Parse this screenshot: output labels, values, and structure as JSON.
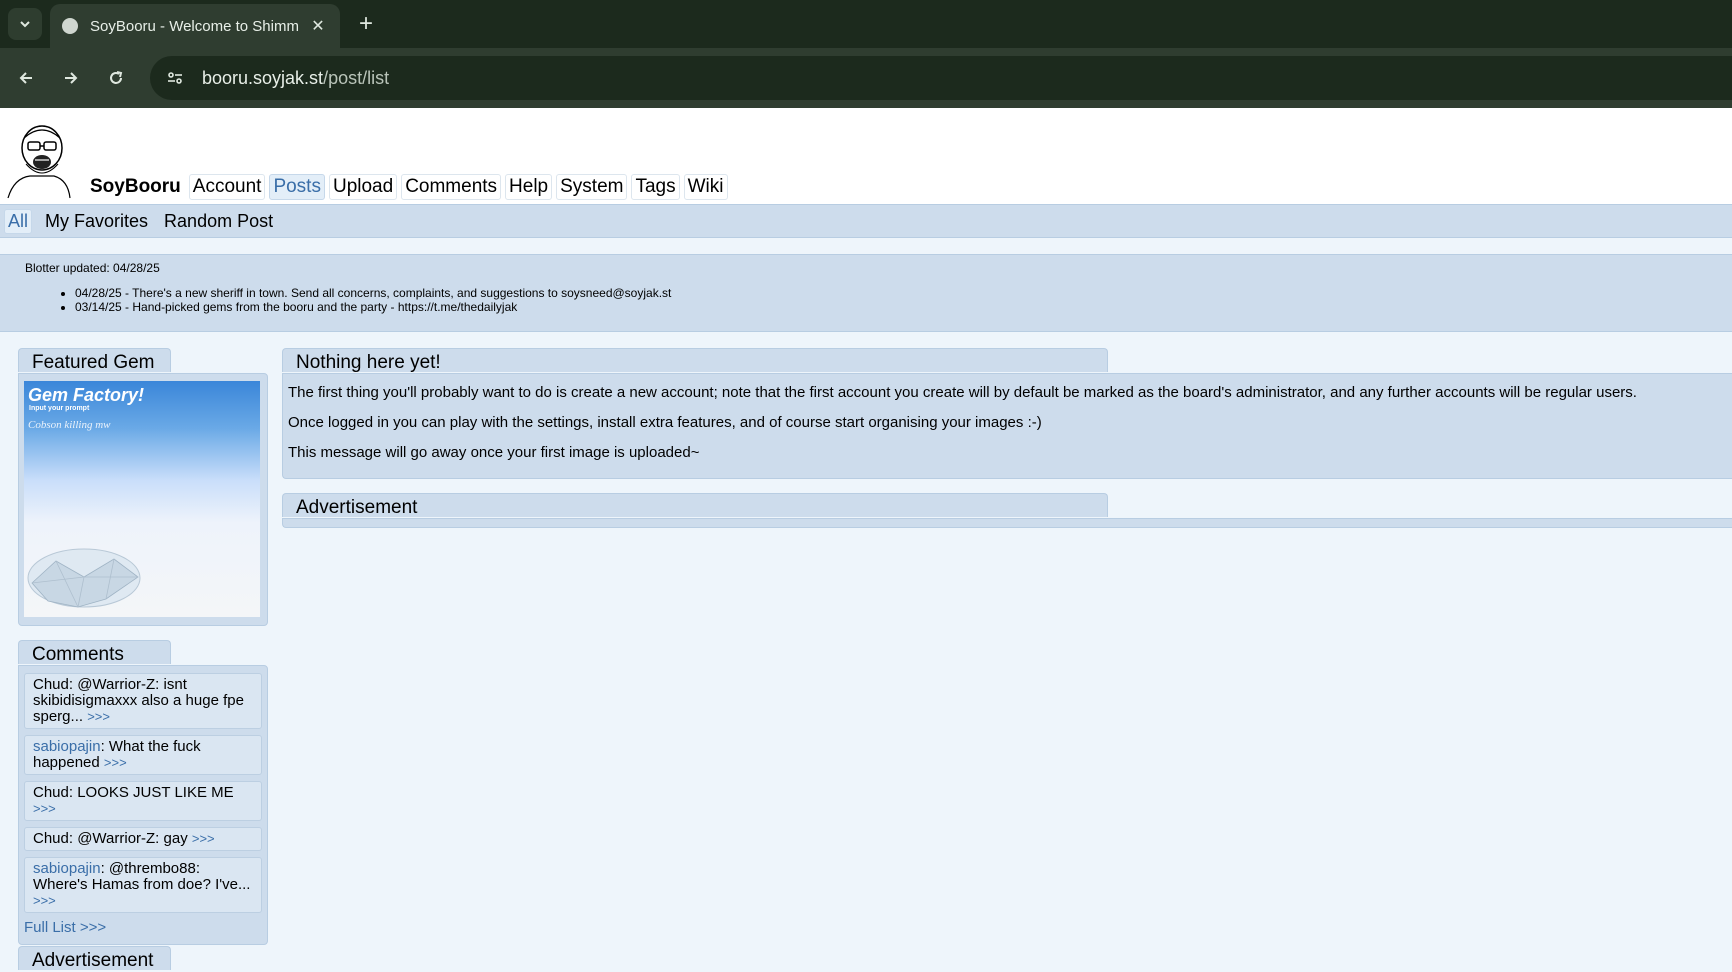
{
  "browser": {
    "tab_title": "SoyBooru - Welcome to Shimmie",
    "url_host": "booru.soyjak.st",
    "url_path": "/post/list"
  },
  "header": {
    "site_name": "SoyBooru",
    "nav": [
      "Account",
      "Posts",
      "Upload",
      "Comments",
      "Help",
      "System",
      "Tags",
      "Wiki"
    ],
    "active_nav": "Posts"
  },
  "subnav": [
    "All",
    "My Favorites",
    "Random Post"
  ],
  "blotter": {
    "updated": "Blotter updated: 04/28/25",
    "entries": [
      "04/28/25 - There's a new sheriff in town. Send all concerns, complaints, and suggestions to soysneed@soyjak.st",
      "03/14/25 - Hand-picked gems from the booru and the party - https://t.me/thedailyjak"
    ]
  },
  "featured": {
    "title": "Featured Gem",
    "image_title": "Gem Factory!",
    "image_sub": "Input your prompt",
    "image_sub2": "Cobson killing mw"
  },
  "comments": {
    "title": "Comments",
    "items": [
      {
        "user": "Chud",
        "text": ": @Warrior-Z: isnt skibidisigmaxxx also a huge fpe sperg...",
        "more": ">>>"
      },
      {
        "user": "sabiopajin",
        "text": ": What the fuck happened",
        "more": ">>>"
      },
      {
        "user": "Chud",
        "text": ": LOOKS JUST LIKE ME",
        "more": ">>>"
      },
      {
        "user": "Chud",
        "text": ": @Warrior-Z: gay",
        "more": ">>>"
      },
      {
        "user": "sabiopajin",
        "text": ": @thrembo88: Where's Hamas from doe? I've...",
        "more": ">>>"
      }
    ],
    "full_list": "Full List >>>"
  },
  "ad_left_title": "Advertisement",
  "main": {
    "title": "Nothing here yet!",
    "p1": "The first thing you'll probably want to do is create a new account; note that the first account you create will by default be marked as the board's administrator, and any further accounts will be regular users.",
    "p2": "Once logged in you can play with the settings, install extra features, and of course start organising your images :-)",
    "p3": "This message will go away once your first image is uploaded~",
    "ad_title": "Advertisement"
  }
}
